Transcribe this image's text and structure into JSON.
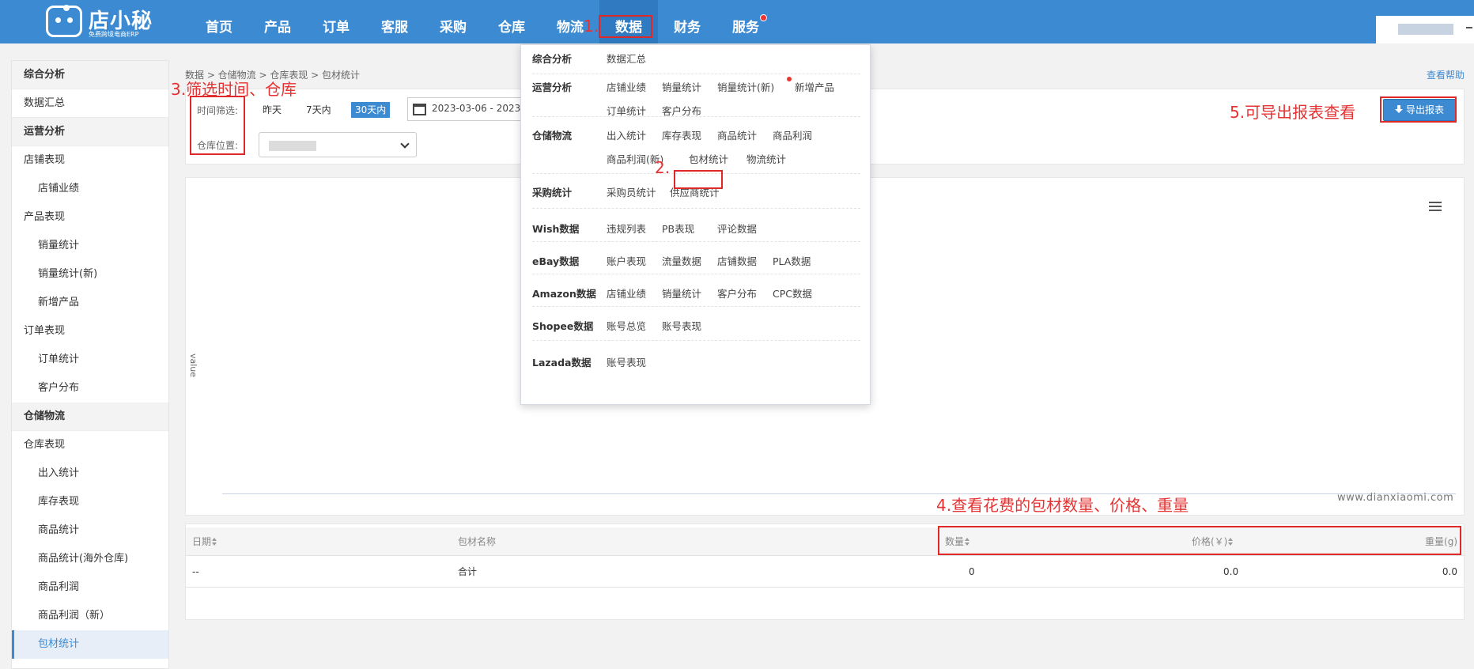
{
  "brand": {
    "name": "店小秘",
    "slogan": "免费跨境电商ERP"
  },
  "nav": [
    "首页",
    "产品",
    "订单",
    "客服",
    "采购",
    "仓库",
    "物流",
    "数据",
    "财务",
    "服务"
  ],
  "sidebar": [
    {
      "label": "综合分析",
      "kind": "group"
    },
    {
      "label": "数据汇总",
      "kind": "item"
    },
    {
      "label": "运营分析",
      "kind": "group"
    },
    {
      "label": "店铺表现",
      "kind": "cat"
    },
    {
      "label": "店铺业绩",
      "kind": "sub"
    },
    {
      "label": "产品表现",
      "kind": "cat"
    },
    {
      "label": "销量统计",
      "kind": "sub"
    },
    {
      "label": "销量统计(新)",
      "kind": "sub"
    },
    {
      "label": "新增产品",
      "kind": "sub"
    },
    {
      "label": "订单表现",
      "kind": "cat"
    },
    {
      "label": "订单统计",
      "kind": "sub"
    },
    {
      "label": "客户分布",
      "kind": "sub"
    },
    {
      "label": "仓储物流",
      "kind": "group"
    },
    {
      "label": "仓库表现",
      "kind": "cat"
    },
    {
      "label": "出入统计",
      "kind": "sub"
    },
    {
      "label": "库存表现",
      "kind": "sub"
    },
    {
      "label": "商品统计",
      "kind": "sub"
    },
    {
      "label": "商品统计(海外仓库)",
      "kind": "sub"
    },
    {
      "label": "商品利润",
      "kind": "sub"
    },
    {
      "label": "商品利润（新）",
      "kind": "sub"
    },
    {
      "label": "包材统计",
      "kind": "sub",
      "active": true
    }
  ],
  "breadcrumb": "数据 > 仓储物流 > 仓库表现 > 包材统计",
  "help": "查看帮助",
  "filter": {
    "time_label": "时间筛选:",
    "options": [
      "昨天",
      "7天内",
      "30天内"
    ],
    "date_range": "2023-03-06 - 2023-0",
    "warehouse_label": "仓库位置:",
    "export_label": "导出报表"
  },
  "chart": {
    "y_label": "value",
    "watermark": "www.dianxiaomi.com"
  },
  "table": {
    "headers": {
      "date": "日期",
      "name": "包材名称",
      "qty": "数量",
      "price": "价格(￥)",
      "weight": "重量(g)"
    },
    "total_row": {
      "date": "--",
      "name": "合计",
      "qty": "0",
      "price": "0.0",
      "weight": "0.0"
    }
  },
  "mega_menu": [
    {
      "category": "综合分析",
      "links": [
        [
          "数据汇总"
        ]
      ]
    },
    {
      "category": "运营分析",
      "links": [
        [
          "店铺业绩",
          "销量统计",
          "销量统计(新)",
          "新增产品"
        ],
        [
          "订单统计",
          "客户分布"
        ]
      ]
    },
    {
      "category": "仓储物流",
      "links": [
        [
          "出入统计",
          "库存表现",
          "商品统计",
          "商品利润"
        ],
        [
          "商品利润(新)",
          "包材统计",
          "物流统计"
        ]
      ]
    },
    {
      "category": "采购统计",
      "links": [
        [
          "采购员统计",
          "供应商统计"
        ]
      ]
    },
    {
      "category": "Wish数据",
      "links": [
        [
          "违规列表",
          "PB表现",
          "评论数据"
        ]
      ]
    },
    {
      "category": "eBay数据",
      "links": [
        [
          "账户表现",
          "流量数据",
          "店铺数据",
          "PLA数据"
        ]
      ]
    },
    {
      "category": "Amazon数据",
      "links": [
        [
          "店铺业绩",
          "销量统计",
          "客户分布",
          "CPC数据"
        ]
      ]
    },
    {
      "category": "Shopee数据",
      "links": [
        [
          "账号总览",
          "账号表现"
        ]
      ]
    },
    {
      "category": "Lazada数据",
      "links": [
        [
          "账号表现"
        ]
      ]
    }
  ],
  "annotations": {
    "step1": "1.",
    "step2": "2.",
    "step3": "3.筛选时间、仓库",
    "step4": "4.查看花费的包材数量、价格、重量",
    "step5": "5.可导出报表查看"
  },
  "colors": {
    "brand_blue": "#3c8bd2",
    "annotation_red": "#e53333"
  }
}
